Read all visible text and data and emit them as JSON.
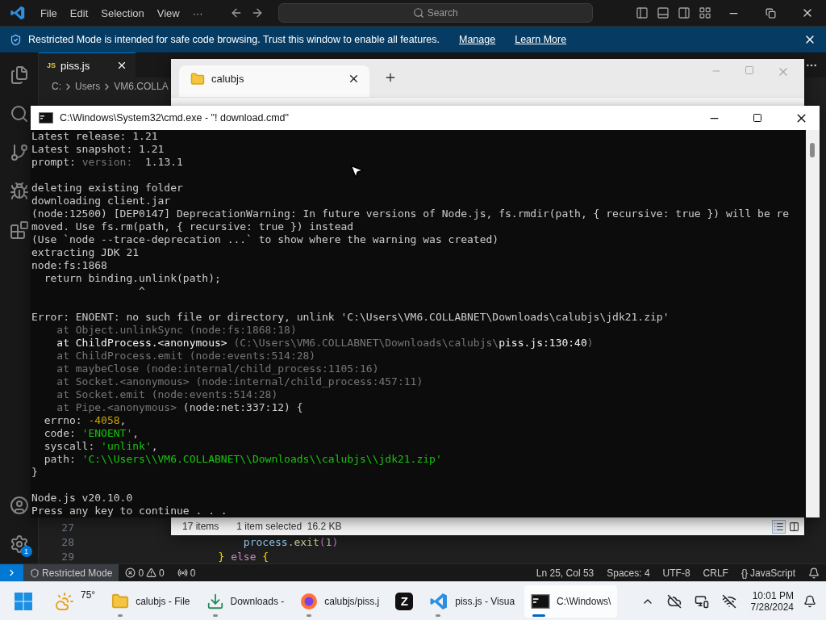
{
  "titlebar": {
    "menus": [
      "File",
      "Edit",
      "Selection",
      "View",
      "···"
    ],
    "search": {
      "placeholder": "Search"
    }
  },
  "banner": {
    "message": "Restricted Mode is intended for safe code browsing. Trust this window to enable all features.",
    "links": [
      "Manage",
      "Learn More"
    ]
  },
  "activity_bar": {
    "settings_badge": "1"
  },
  "editor": {
    "tabs": [
      {
        "icon_text": "JS",
        "label": "piss.js",
        "selected": true
      }
    ],
    "breadcrumbs": [
      "C:",
      "Users",
      "VM6.COLLA"
    ],
    "lines": [
      {
        "number": "27"
      },
      {
        "number": "28",
        "segments": [
          {
            "text": "                        process",
            "kind": "variable"
          },
          {
            "text": ".",
            "kind": "plain"
          },
          {
            "text": "exit",
            "kind": "function"
          },
          {
            "text": "(",
            "kind": "bracket"
          },
          {
            "text": "1",
            "kind": "number"
          },
          {
            "text": ")",
            "kind": "bracket"
          }
        ]
      },
      {
        "number": "29",
        "segments": [
          {
            "text": "                    }",
            "kind": "brace"
          },
          {
            "text": " else",
            "kind": "keyword"
          },
          {
            "text": " {",
            "kind": "brace"
          }
        ]
      }
    ]
  },
  "explorer_window": {
    "tabs": [
      {
        "label": "calubjs",
        "selected": true
      }
    ],
    "item_count": "17 items",
    "selection": "1 item selected  16.2 KB",
    "views": [
      {
        "kind": "details",
        "selected": true
      },
      {
        "kind": "tiles",
        "selected": false
      }
    ]
  },
  "cmd_window": {
    "title": "C:\\Windows\\System32\\cmd.exe - \"! download.cmd\"",
    "lines": [
      {
        "kind": "text",
        "segments": [
          {
            "text": "Latest release: 1.21",
            "kind": "plain"
          }
        ]
      },
      {
        "kind": "text",
        "segments": [
          {
            "text": "Latest snapshot: 1.21",
            "kind": "plain"
          }
        ]
      },
      {
        "kind": "text",
        "segments": [
          {
            "text": "prompt: ",
            "kind": "plain"
          },
          {
            "text": "version: ",
            "kind": "dim"
          },
          {
            "text": " 1.13.1",
            "kind": "plain"
          }
        ]
      },
      {
        "kind": "blank"
      },
      {
        "kind": "text",
        "segments": [
          {
            "text": "deleting existing folder",
            "kind": "plain"
          }
        ]
      },
      {
        "kind": "text",
        "segments": [
          {
            "text": "downloading client.jar",
            "kind": "plain"
          }
        ]
      },
      {
        "kind": "text",
        "segments": [
          {
            "text": "(node:12500) [DEP0147] DeprecationWarning: In future versions of Node.js, fs.rmdir(path, { recursive: true }) will be re",
            "kind": "plain"
          }
        ]
      },
      {
        "kind": "text",
        "segments": [
          {
            "text": "moved. Use fs.rm(path, { recursive: true }) instead",
            "kind": "plain"
          }
        ]
      },
      {
        "kind": "text",
        "segments": [
          {
            "text": "(Use `node --trace-deprecation ...` to show where the warning was created)",
            "kind": "plain"
          }
        ]
      },
      {
        "kind": "text",
        "segments": [
          {
            "text": "extracting JDK 21",
            "kind": "plain"
          }
        ]
      },
      {
        "kind": "text",
        "segments": [
          {
            "text": "node:fs:1868",
            "kind": "plain"
          }
        ]
      },
      {
        "kind": "text",
        "segments": [
          {
            "text": "  return binding.unlink(path);",
            "kind": "plain"
          }
        ]
      },
      {
        "kind": "text",
        "segments": [
          {
            "text": "                 ^",
            "kind": "plain"
          }
        ]
      },
      {
        "kind": "blank"
      },
      {
        "kind": "text",
        "segments": [
          {
            "text": "Error: ENOENT: no such file or directory, unlink 'C:\\Users\\VM6.COLLABNET\\Downloads\\calubjs\\jdk21.zip'",
            "kind": "plain"
          }
        ]
      },
      {
        "kind": "text",
        "segments": [
          {
            "text": "    at Object.unlinkSync (node:fs:1868:18)",
            "kind": "dim"
          }
        ]
      },
      {
        "kind": "text",
        "segments": [
          {
            "text": "    at ChildProcess.<anonymous> ",
            "kind": "bright"
          },
          {
            "text": "(C:\\Users\\VM6.COLLABNET\\Downloads\\calubjs\\",
            "kind": "dim"
          },
          {
            "text": "piss.js:130:40",
            "kind": "bright"
          },
          {
            "text": ")",
            "kind": "dim"
          }
        ]
      },
      {
        "kind": "text",
        "segments": [
          {
            "text": "    at ChildProcess.emit (node:events:514:28)",
            "kind": "dim"
          }
        ]
      },
      {
        "kind": "text",
        "segments": [
          {
            "text": "    at maybeClose (node:internal/child_process:1105:16)",
            "kind": "dim"
          }
        ]
      },
      {
        "kind": "text",
        "segments": [
          {
            "text": "    at Socket.<anonymous> (node:internal/child_process:457:11)",
            "kind": "dim"
          }
        ]
      },
      {
        "kind": "text",
        "segments": [
          {
            "text": "    at Socket.emit (node:events:514:28)",
            "kind": "dim"
          }
        ]
      },
      {
        "kind": "text",
        "segments": [
          {
            "text": "    at Pipe.<anonymous> ",
            "kind": "dim"
          },
          {
            "text": "(node:net:337:12) {",
            "kind": "plain"
          }
        ]
      },
      {
        "kind": "text",
        "segments": [
          {
            "text": "  errno: ",
            "kind": "plain"
          },
          {
            "text": "-4058",
            "kind": "number"
          },
          {
            "text": ",",
            "kind": "plain"
          }
        ]
      },
      {
        "kind": "text",
        "segments": [
          {
            "text": "  code: ",
            "kind": "plain"
          },
          {
            "text": "'ENOENT'",
            "kind": "string"
          },
          {
            "text": ",",
            "kind": "plain"
          }
        ]
      },
      {
        "kind": "text",
        "segments": [
          {
            "text": "  syscall: ",
            "kind": "plain"
          },
          {
            "text": "'unlink'",
            "kind": "string"
          },
          {
            "text": ",",
            "kind": "plain"
          }
        ]
      },
      {
        "kind": "text",
        "segments": [
          {
            "text": "  path: ",
            "kind": "plain"
          },
          {
            "text": "'C:\\\\Users\\\\VM6.COLLABNET\\\\Downloads\\\\calubjs\\\\jdk21.zip'",
            "kind": "string"
          }
        ]
      },
      {
        "kind": "text",
        "segments": [
          {
            "text": "}",
            "kind": "plain"
          }
        ]
      },
      {
        "kind": "blank"
      },
      {
        "kind": "text",
        "segments": [
          {
            "text": "Node.js v20.10.0",
            "kind": "plain"
          }
        ]
      },
      {
        "kind": "text",
        "segments": [
          {
            "text": "Press any key to continue . . .",
            "kind": "plain"
          }
        ]
      }
    ]
  },
  "status_bar": {
    "restricted": "Restricted Mode",
    "errors": "0",
    "warnings": "0",
    "ports": "0",
    "items": [
      "Ln 25, Col 53",
      "Spaces: 4",
      "UTF-8",
      "CRLF"
    ],
    "language": {
      "glyph": "{}",
      "label": "JavaScript"
    }
  },
  "taskbar": {
    "weather": "75°",
    "apps": [
      {
        "kind": "explorer",
        "label": "calubjs - File",
        "running": true,
        "selected": false
      },
      {
        "kind": "downloads",
        "label": "Downloads -",
        "running": true,
        "selected": false
      },
      {
        "kind": "firefox",
        "label": "calubjs/piss.j",
        "running": true,
        "selected": false
      },
      {
        "kind": "zed",
        "logo": "Z",
        "running": false,
        "selected": false
      },
      {
        "kind": "vscode",
        "label": "piss.js - Visua",
        "running": true,
        "selected": false
      },
      {
        "kind": "cmd",
        "label": "C:\\Windows\\",
        "running": true,
        "selected": true
      }
    ],
    "clock": {
      "time": "10:01 PM",
      "date": "7/28/2024"
    }
  }
}
